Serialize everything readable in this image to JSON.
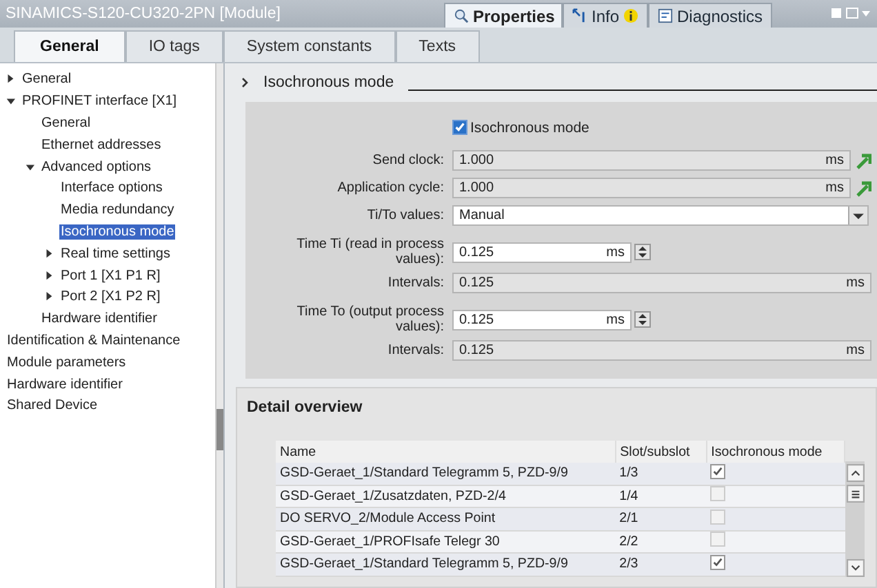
{
  "window": {
    "title": "SINAMICS-S120-CU320-2PN [Module]"
  },
  "inspector_tabs": [
    {
      "label": "Properties",
      "selected": true,
      "kind": "properties"
    },
    {
      "label": "Info",
      "selected": false,
      "kind": "info"
    },
    {
      "label": "Diagnostics",
      "selected": false,
      "kind": "diagnostics"
    }
  ],
  "tabs": [
    {
      "label": "General",
      "selected": true
    },
    {
      "label": "IO tags",
      "selected": false
    },
    {
      "label": "System constants",
      "selected": false
    },
    {
      "label": "Texts",
      "selected": false
    }
  ],
  "sidebar": {
    "items": [
      {
        "label": "General",
        "expanded": false,
        "selected": false
      },
      {
        "label": "PROFINET interface [X1]",
        "expanded": true,
        "selected": false,
        "children": [
          {
            "label": "General",
            "selected": false
          },
          {
            "label": "Ethernet addresses",
            "selected": false
          },
          {
            "label": "Advanced options",
            "expanded": true,
            "selected": false,
            "children": [
              {
                "label": "Interface options",
                "selected": false
              },
              {
                "label": "Media redundancy",
                "selected": false
              },
              {
                "label": "Isochronous mode",
                "selected": true
              },
              {
                "label": "Real time settings",
                "expanded": false,
                "selected": false
              },
              {
                "label": "Port 1 [X1 P1 R]",
                "expanded": false,
                "selected": false
              },
              {
                "label": "Port 2 [X1 P2 R]",
                "expanded": false,
                "selected": false
              }
            ]
          },
          {
            "label": "Hardware identifier",
            "selected": false
          }
        ]
      },
      {
        "label": "Identification & Maintenance",
        "selected": false
      },
      {
        "label": "Module parameters",
        "selected": false
      },
      {
        "label": "Hardware identifier",
        "selected": false
      },
      {
        "label": "Shared Device",
        "selected": false
      }
    ]
  },
  "section": {
    "title": "Isochronous mode",
    "fields": [
      {
        "kind": "checkbox",
        "label": "Isochronous mode",
        "checked": true
      },
      {
        "kind": "readonly_link",
        "label": "Send clock:",
        "value": "1.000",
        "unit": "ms"
      },
      {
        "kind": "readonly_link",
        "label": "Application cycle:",
        "value": "1.000",
        "unit": "ms"
      },
      {
        "kind": "dropdown",
        "label": "Ti/To values:",
        "value": "Manual"
      },
      {
        "kind": "spinner",
        "label": "Time Ti (read in process values):",
        "value": "0.125",
        "unit": "ms"
      },
      {
        "kind": "readonly",
        "label": "Intervals:",
        "value": "0.125",
        "unit": "ms"
      },
      {
        "kind": "spinner",
        "label": "Time To (output process values):",
        "value": "0.125",
        "unit": "ms"
      },
      {
        "kind": "readonly",
        "label": "Intervals:",
        "value": "0.125",
        "unit": "ms"
      }
    ]
  },
  "detail_overview": {
    "title": "Detail overview",
    "table": {
      "columns": [
        "Name",
        "Slot/subslot",
        "Isochronous mode"
      ],
      "rows": [
        {
          "name": "GSD-Geraet_1/Standard Telegramm 5, PZD-9/9",
          "slot": "1/3",
          "checked": true
        },
        {
          "name": "GSD-Geraet_1/Zusatzdaten, PZD-2/4",
          "slot": "1/4",
          "checked": false
        },
        {
          "name": "DO SERVO_2/Module Access Point",
          "slot": "2/1",
          "checked": false
        },
        {
          "name": "GSD-Geraet_1/PROFIsafe Telegr 30",
          "slot": "2/2",
          "checked": false
        },
        {
          "name": "GSD-Geraet_1/Standard Telegramm 5, PZD-9/9",
          "slot": "2/3",
          "checked": true
        }
      ]
    }
  }
}
